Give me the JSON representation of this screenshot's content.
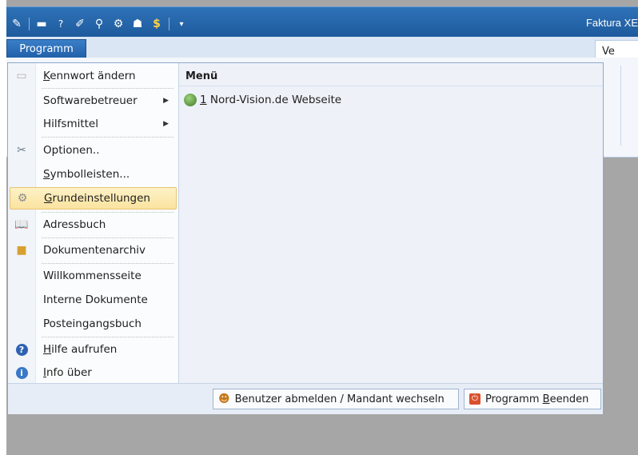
{
  "titlebar": {
    "app_title": "Faktura XE",
    "qat_icons": [
      "app-icon",
      "window-icon",
      "help-icon",
      "edit-icon",
      "search-icon",
      "tools-icon",
      "people-icon",
      "dollar-icon",
      "customize-icon"
    ]
  },
  "ribbon": {
    "program_tab": "Programm",
    "right_tab": "Ve"
  },
  "menu": {
    "items": [
      {
        "label": "Kennwort ändern",
        "ul": "K",
        "rest": "ennwort ändern",
        "icon": "password-icon"
      },
      {
        "label": "Softwarebetreuer",
        "submenu": true
      },
      {
        "label": "Hilfsmittel",
        "submenu": true
      },
      {
        "label": "Optionen..",
        "icon": "tools-icon"
      },
      {
        "label": "Symbolleisten...",
        "ul": "S",
        "rest": "ymbolleisten..."
      },
      {
        "label": "Grundeinstellungen",
        "ul": "G",
        "rest": "rundeinstellungen",
        "icon": "gear-icon",
        "highlighted": true
      },
      {
        "label": "Adressbuch",
        "icon": "book-icon"
      },
      {
        "label": "Dokumentenarchiv",
        "icon": "box-icon"
      },
      {
        "label": "Willkommensseite"
      },
      {
        "label": "Interne Dokumente"
      },
      {
        "label": "Posteingangsbuch"
      },
      {
        "label": "Hilfe aufrufen",
        "ul": "H",
        "rest": "ilfe aufrufen",
        "icon": "help-icon"
      },
      {
        "label": "Info über",
        "ul": "I",
        "rest": "nfo über",
        "icon": "info-icon"
      }
    ],
    "right_header": "Menü",
    "recent": {
      "number": "1",
      "label": "Nord-Vision.de Webseite"
    },
    "footer": {
      "logout": "Benutzer abmelden / Mandant wechseln",
      "quit_pre": "Programm ",
      "quit_ul": "B",
      "quit_post": "eenden"
    }
  }
}
